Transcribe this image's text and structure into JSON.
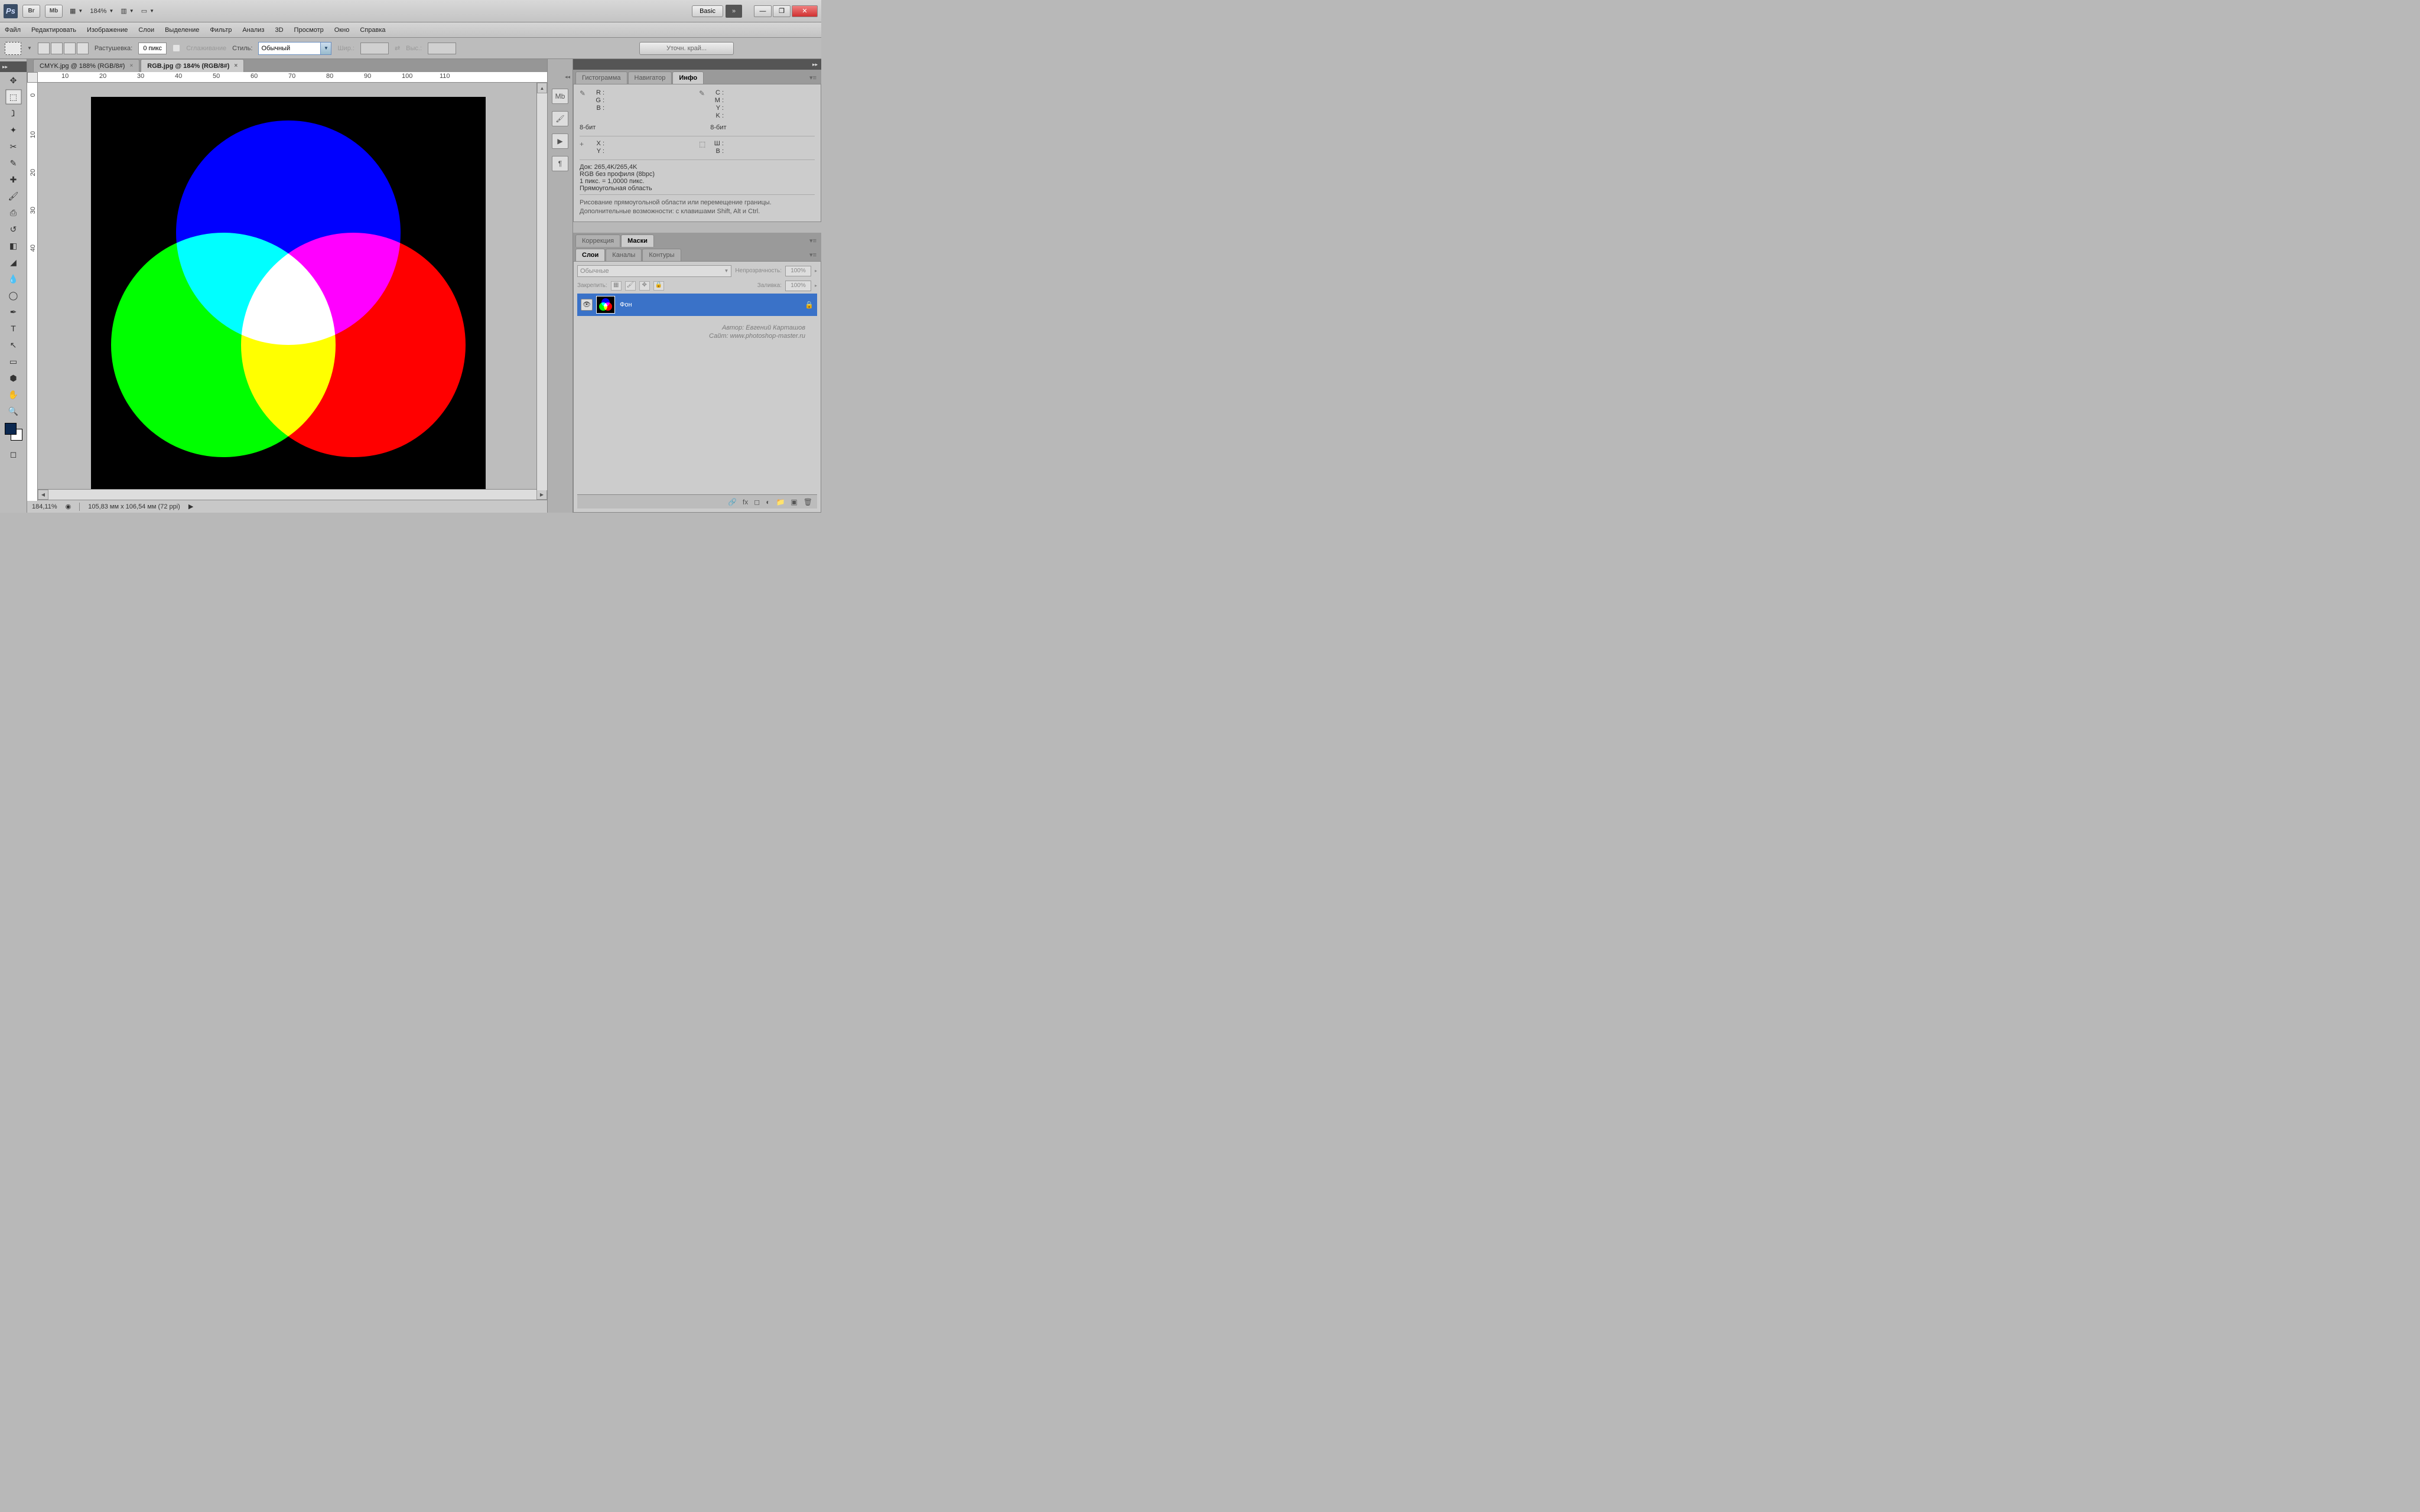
{
  "app": {
    "logo": "Ps",
    "workspace": "Basic",
    "zoom_display": "184%"
  },
  "titlebar_buttons": {
    "br": "Br",
    "mb": "Mb"
  },
  "menu": [
    "Файл",
    "Редактировать",
    "Изображение",
    "Слои",
    "Выделение",
    "Фильтр",
    "Анализ",
    "3D",
    "Просмотр",
    "Окно",
    "Справка"
  ],
  "options": {
    "feather_label": "Растушевка:",
    "feather_value": "0 пикс",
    "antialias": "Сглаживание",
    "style_label": "Стиль:",
    "style_value": "Обычный",
    "width_label": "Шир.:",
    "height_label": "Выс.:",
    "refine": "Уточн. край..."
  },
  "tabs": [
    {
      "title": "CMYK.jpg @ 188% (RGB/8#)",
      "active": false
    },
    {
      "title": "RGB.jpg @ 184% (RGB/8#)",
      "active": true
    }
  ],
  "ruler_h": [
    "10",
    "20",
    "30",
    "40",
    "50",
    "60",
    "70",
    "80",
    "90",
    "100",
    "110"
  ],
  "ruler_v": [
    "0",
    "10",
    "20",
    "30",
    "40"
  ],
  "status": {
    "zoom": "184,11%",
    "docsize": "105,83 мм x 106,54 мм (72 ppi)"
  },
  "panels": {
    "top_tabs": [
      "Гистограмма",
      "Навигатор",
      "Инфо"
    ],
    "info": {
      "rgb": {
        "R": "R :",
        "G": "G :",
        "B": "B :"
      },
      "cmyk": {
        "C": "C :",
        "M": "M :",
        "Y": "Y :",
        "K": "K :"
      },
      "bits_l": "8-бит",
      "bits_r": "8-бит",
      "xy": {
        "X": "X :",
        "Y": "Y :"
      },
      "wh": {
        "W": "Ш :",
        "H": "В :"
      },
      "doc": "Док: 265,4K/265,4K",
      "profile": "RGB без профиля (8bpc)",
      "pixel": "1 пикс. = 1,0000 пикс.",
      "region": "Прямоугольная область",
      "hint": "Рисование прямоугольной области или перемещение границы. Дополнительные возможности: с клавишами Shift, Alt и Ctrl."
    },
    "mid_tabs": [
      "Коррекция",
      "Маски"
    ],
    "layer_tabs": [
      "Слои",
      "Каналы",
      "Контуры"
    ],
    "layers": {
      "blend": "Обычные",
      "opacity_label": "Непрозрачность:",
      "opacity_value": "100%",
      "lock_label": "Закрепить:",
      "fill_label": "Заливка:",
      "fill_value": "100%",
      "items": [
        {
          "name": "Фон"
        }
      ]
    }
  },
  "watermark": {
    "line1": "Автор: Евгений Карташов",
    "line2": "Сайт: www.photoshop-master.ru"
  }
}
